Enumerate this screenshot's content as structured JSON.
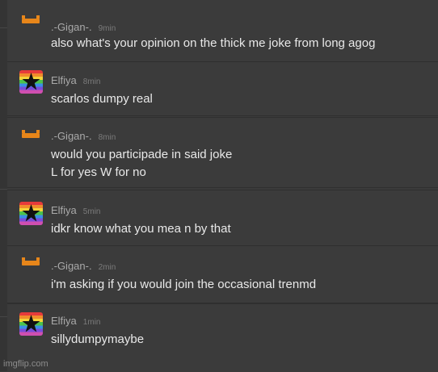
{
  "watermark": "imgflip.com",
  "messages": [
    {
      "user": "gigan",
      "name": ".-Gigan-.",
      "time": "9min",
      "lines": [
        "also what's your opinion on the thick me joke from long agog"
      ]
    },
    {
      "user": "elfiya",
      "name": "Elfiya",
      "time": "8min",
      "lines": [
        "scarlos dumpy real"
      ]
    },
    {
      "user": "gigan",
      "name": ".-Gigan-.",
      "time": "8min",
      "lines": [
        "would you participade in said joke",
        "L for yes W for no"
      ]
    },
    {
      "user": "elfiya",
      "name": "Elfiya",
      "time": "5min",
      "lines": [
        "idkr know what you mea n by that"
      ]
    },
    {
      "user": "gigan",
      "name": ".-Gigan-.",
      "time": "2min",
      "lines": [
        "i'm asking if you would join the occasional trenmd"
      ]
    },
    {
      "user": "elfiya",
      "name": "Elfiya",
      "time": "1min",
      "lines": [
        "sillydumpymaybe"
      ]
    }
  ],
  "avatar_icons": {
    "gigan": "orange-face-icon",
    "elfiya": "rainbow-star-icon"
  },
  "colors": {
    "background": "#3b3b3b",
    "gigan_orange": "#e7861a",
    "text": "#e9e9e9",
    "meta": "#7b7b7b"
  }
}
